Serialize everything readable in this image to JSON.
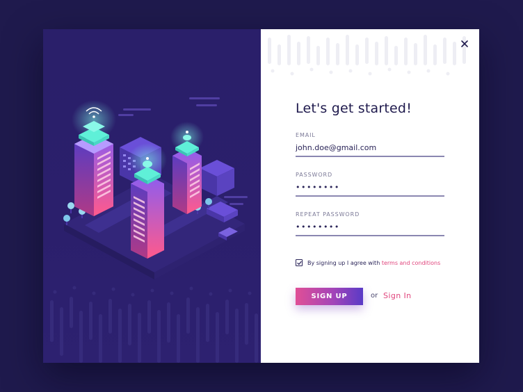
{
  "form": {
    "title": "Let's get started!",
    "email": {
      "label": "EMAIL",
      "value": "john.doe@gmail.com"
    },
    "password": {
      "label": "PASSWORD",
      "value": "••••••••"
    },
    "repeat_password": {
      "label": "REPEAT PASSWORD",
      "value": "••••••••"
    },
    "terms": {
      "checked": true,
      "text": "By signing up I agree with ",
      "link": "terms and conditions"
    },
    "signup_label": "SIGN UP",
    "or_text": "or",
    "signin_label": "Sign In"
  },
  "icons": {
    "close": "close-icon",
    "checkmark": "checkmark-icon",
    "illustration": "isometric-smart-city-illustration"
  },
  "colors": {
    "page_background": "#1f1a4d",
    "left_panel": "#2b1f6c",
    "accent_pink": "#e0447c",
    "button_start": "#e04f96",
    "button_end": "#5a3bc6",
    "tower_teal": "#5ff0d8"
  }
}
